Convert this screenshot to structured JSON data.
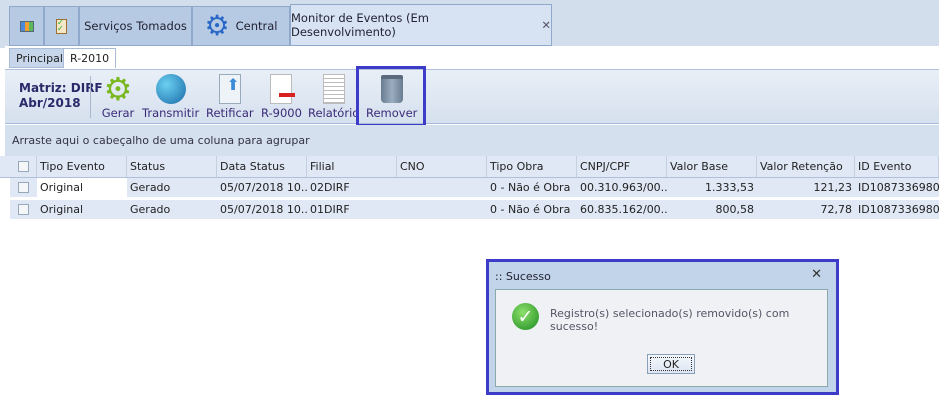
{
  "tabs": [
    {
      "label": ""
    },
    {
      "label": ""
    },
    {
      "label": "Serviços Tomados"
    },
    {
      "label": "Central"
    },
    {
      "label": "Monitor de Eventos (Em Desenvolvimento)"
    }
  ],
  "subtabs": [
    "Principal",
    "R-2010"
  ],
  "toolbar": {
    "matriz": "Matriz: DIRF",
    "periodo": "Abr/2018",
    "buttons": [
      "Gerar",
      "Transmitir",
      "Retificar",
      "R-9000",
      "Relatório",
      "Remover"
    ]
  },
  "group_hint": "Arraste aqui o cabeçalho de uma coluna para agrupar",
  "columns": [
    "Tipo Evento",
    "Status",
    "Data Status",
    "Filial",
    "CNO",
    "Tipo Obra",
    "CNPJ/CPF",
    "Valor Base",
    "Valor Retenção",
    "ID Evento"
  ],
  "rows": [
    [
      "Original",
      "Gerado",
      "05/07/2018 10...",
      "02DIRF",
      "",
      "0 - Não é Obra",
      "00.310.963/00...",
      "1.333,53",
      "121,23",
      "ID1087336980..."
    ],
    [
      "Original",
      "Gerado",
      "05/07/2018 10...",
      "01DIRF",
      "",
      "0 - Não é Obra",
      "60.835.162/00...",
      "800,58",
      "72,78",
      "ID1087336980..."
    ]
  ],
  "dialog": {
    "title": ":: Sucesso",
    "message": "Registro(s) selecionado(s) removido(s) com sucesso!",
    "ok": "OK"
  },
  "colors": {
    "highlight": "#3c3cc8",
    "tabbar": "#b7cae3",
    "grid": "#dfe8f4"
  }
}
